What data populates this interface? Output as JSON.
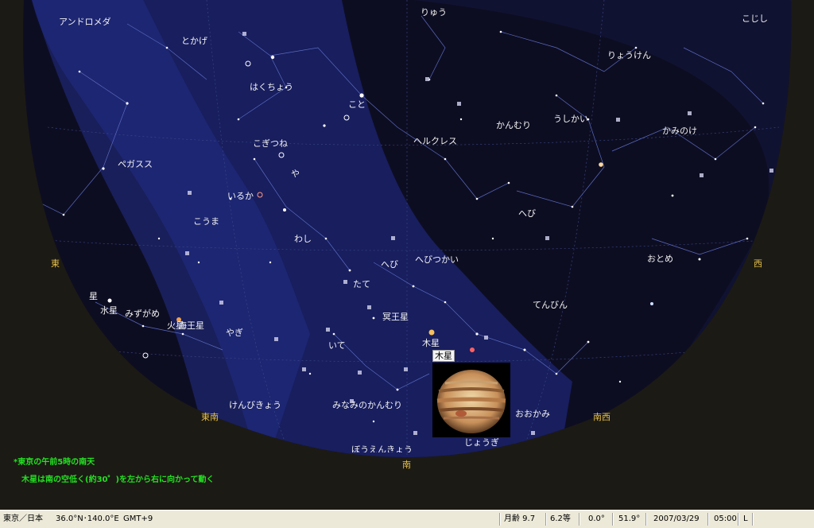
{
  "sky": {
    "colors": {
      "background": "#1c1a14",
      "sky": "#0d0d22",
      "milky_way": "#1a2060",
      "labels": "#f2f2f2",
      "directions": "#e6c04a",
      "note": "#22e022"
    },
    "constellations": [
      {
        "id": "andromeda",
        "label": "アンドロメダ"
      },
      {
        "id": "ryu",
        "label": "りゅう"
      },
      {
        "id": "kojishi",
        "label": "こじし"
      },
      {
        "id": "tokage",
        "label": "とかげ"
      },
      {
        "id": "ryoken",
        "label": "りょうけん"
      },
      {
        "id": "hakucho",
        "label": "はくちょう"
      },
      {
        "id": "koto",
        "label": "こと"
      },
      {
        "id": "kanmuri",
        "label": "かんむり"
      },
      {
        "id": "ushikai",
        "label": "うしかい"
      },
      {
        "id": "kaminoke",
        "label": "かみのけ"
      },
      {
        "id": "kogitsune",
        "label": "こぎつね"
      },
      {
        "id": "herakuresu",
        "label": "ヘルクレス"
      },
      {
        "id": "pegasusu",
        "label": "ペガスス"
      },
      {
        "id": "ya",
        "label": "や"
      },
      {
        "id": "iruka",
        "label": "いるか"
      },
      {
        "id": "kouma",
        "label": "こうま"
      },
      {
        "id": "hebi1",
        "label": "へび"
      },
      {
        "id": "washi",
        "label": "わし"
      },
      {
        "id": "hebi2",
        "label": "へび"
      },
      {
        "id": "hebitsukai",
        "label": "へびつかい"
      },
      {
        "id": "otome",
        "label": "おとめ"
      },
      {
        "id": "tate",
        "label": "たて"
      },
      {
        "id": "mizugame",
        "label": "みずがめ"
      },
      {
        "id": "tenbin",
        "label": "てんびん"
      },
      {
        "id": "yagi",
        "label": "やぎ"
      },
      {
        "id": "ite",
        "label": "いて"
      },
      {
        "id": "kenbikyo",
        "label": "けんびきょう"
      },
      {
        "id": "minaminokanmuri",
        "label": "みなみのかんむり"
      },
      {
        "id": "ookami",
        "label": "おおかみ"
      },
      {
        "id": "jogi",
        "label": "じょうぎ"
      },
      {
        "id": "bokyo",
        "label": "ぼうえんきょう"
      }
    ],
    "planets": [
      {
        "id": "kasei",
        "label": "火星"
      },
      {
        "id": "suisei",
        "label": "水星"
      },
      {
        "id": "tenousei",
        "label": "海王星"
      },
      {
        "id": "meiousei",
        "label": "冥王星"
      },
      {
        "id": "mokusei",
        "label": "木星"
      },
      {
        "id": "sei",
        "label": "星"
      }
    ],
    "directions": {
      "east": "東",
      "southeast": "東南",
      "south": "南",
      "southwest": "南西",
      "west": "西"
    },
    "planet_tag": "木星",
    "notes": {
      "line1": "*東京の午前5時の南天",
      "line2": "木星は南の空低く(約30゜)を左から右に向かって動く"
    }
  },
  "status": {
    "location": "東京／日本",
    "coords": "36.0°N･140.0°E",
    "timezone": "GMT+9",
    "moon_age": "月齢 9.7",
    "magnitude": "6.2等",
    "value_a": "0.0°",
    "value_b": "51.9°",
    "date": "2007/03/29",
    "time": "05:00",
    "mode": "L"
  }
}
